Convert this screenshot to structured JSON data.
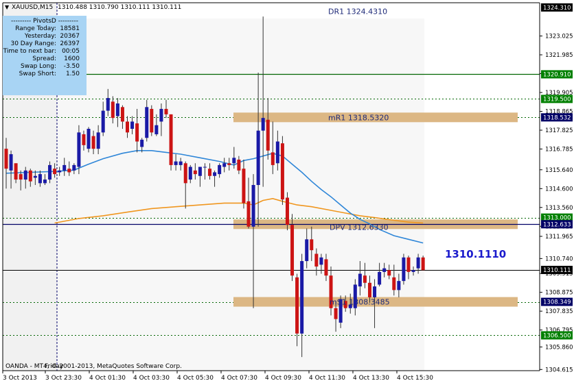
{
  "header": {
    "symbol": "XAUUSD,M15",
    "ohlc": "1310.488 1310.790 1310.111 1310.111"
  },
  "info_panel": {
    "title": "---------  PivotsD  ---------",
    "rows": [
      {
        "label": "Range  Today:",
        "value": "18581"
      },
      {
        "label": "Yesterday:",
        "value": "20367"
      },
      {
        "label": "30 Day Range:",
        "value": "26397"
      },
      {
        "label": "Time to next bar:",
        "value": "00:05"
      },
      {
        "label": "Spread:",
        "value": "1600"
      },
      {
        "label": "Swap  Long:",
        "value": "-3.50"
      },
      {
        "label": "Swap  Short:",
        "value": "1.50"
      }
    ]
  },
  "copyright": "OANDA - MT4, © 2001-2013, MetaQuotes Software Corp.",
  "friday_label": "Friday",
  "big_price": "1310.1110",
  "colors": {
    "bull": "#1a1aa6",
    "bear": "#cc1414",
    "ma_fast": "#2e86d8",
    "ma_slow": "#f0961e",
    "zone": "#dcb784",
    "green_line": "#006400",
    "navy_line": "#000066"
  },
  "chart_data": {
    "type": "candlestick",
    "ylim": [
      1304.55,
      1324.86
    ],
    "y_ticks": [
      "1323.025",
      "1321.985",
      "1320.945",
      "1319.905",
      "1318.865",
      "1317.825",
      "1316.785",
      "1315.640",
      "1314.600",
      "1313.560",
      "1312.520",
      "1311.965",
      "1310.740",
      "1309.915",
      "1308.875",
      "1307.835",
      "1306.795",
      "1305.860",
      "1304.615"
    ],
    "x_ticks": [
      "3 Oct 2013",
      "3 Oct 23:30",
      "4 Oct 01:30",
      "4 Oct 03:30",
      "4 Oct 05:30",
      "4 Oct 07:30",
      "4 Oct 09:30",
      "4 Oct 11:30",
      "4 Oct 13:30",
      "4 Oct 15:30"
    ],
    "price_labels": [
      {
        "text": "1324.310",
        "value": 1324.6,
        "bg": "#000000",
        "fg": "#ffffff"
      },
      {
        "text": "1320.910",
        "value": 1320.91,
        "bg": "#008000",
        "fg": "#ffffff"
      },
      {
        "text": "1319.500",
        "value": 1319.55,
        "bg": "#008000",
        "fg": "#ffffff"
      },
      {
        "text": "1318.532",
        "value": 1318.532,
        "bg": "#000066",
        "fg": "#ffffff"
      },
      {
        "text": "1313.000",
        "value": 1313.0,
        "bg": "#008000",
        "fg": "#ffffff"
      },
      {
        "text": "1312.633",
        "value": 1312.633,
        "bg": "#000066",
        "fg": "#ffffff"
      },
      {
        "text": "1310.111",
        "value": 1310.111,
        "bg": "#000000",
        "fg": "#ffffff"
      },
      {
        "text": "1308.349",
        "value": 1308.349,
        "bg": "#000066",
        "fg": "#ffffff"
      },
      {
        "text": "1306.500",
        "value": 1306.5,
        "bg": "#008000",
        "fg": "#ffffff"
      }
    ],
    "levels": [
      {
        "name": "DR1",
        "text": "DR1   1324.4310",
        "value": 1324.431
      },
      {
        "name": "mR1",
        "text": "mR1   1318.5320",
        "value": 1318.532
      },
      {
        "name": "DPV",
        "text": "DPV   1312.6330",
        "value": 1312.633
      },
      {
        "name": "mS1",
        "text": "mS1   1308.3485",
        "value": 1308.3485
      }
    ],
    "dashed_levels": [
      1319.55,
      1318.532,
      1313.0,
      1308.349,
      1306.5
    ],
    "candles": [
      {
        "o": 1316.8,
        "h": 1317.4,
        "l": 1314.6,
        "c": 1315.7
      },
      {
        "o": 1315.6,
        "h": 1316.7,
        "l": 1314.6,
        "c": 1316.5
      },
      {
        "o": 1316.0,
        "h": 1316.0,
        "l": 1314.9,
        "c": 1315.1
      },
      {
        "o": 1315.4,
        "h": 1315.6,
        "l": 1314.5,
        "c": 1315.1
      },
      {
        "o": 1315.1,
        "h": 1315.8,
        "l": 1314.6,
        "c": 1315.6
      },
      {
        "o": 1315.6,
        "h": 1315.7,
        "l": 1314.7,
        "c": 1315.0
      },
      {
        "o": 1315.2,
        "h": 1315.6,
        "l": 1314.8,
        "c": 1315.3
      },
      {
        "o": 1314.9,
        "h": 1315.6,
        "l": 1314.7,
        "c": 1315.4
      },
      {
        "o": 1314.9,
        "h": 1315.4,
        "l": 1314.8,
        "c": 1315.1
      },
      {
        "o": 1315.1,
        "h": 1316.1,
        "l": 1314.9,
        "c": 1315.9
      },
      {
        "o": 1315.7,
        "h": 1316.0,
        "l": 1315.2,
        "c": 1315.4
      },
      {
        "o": 1315.5,
        "h": 1315.8,
        "l": 1315.3,
        "c": 1315.6
      },
      {
        "o": 1315.6,
        "h": 1316.3,
        "l": 1315.3,
        "c": 1315.9
      },
      {
        "o": 1315.7,
        "h": 1316.1,
        "l": 1315.3,
        "c": 1315.5
      },
      {
        "o": 1315.6,
        "h": 1316.0,
        "l": 1315.4,
        "c": 1315.9
      },
      {
        "o": 1315.8,
        "h": 1318.1,
        "l": 1315.4,
        "c": 1317.7
      },
      {
        "o": 1317.6,
        "h": 1317.8,
        "l": 1316.7,
        "c": 1317.0
      },
      {
        "o": 1316.8,
        "h": 1318.0,
        "l": 1316.6,
        "c": 1317.9
      },
      {
        "o": 1317.5,
        "h": 1317.8,
        "l": 1316.5,
        "c": 1316.8
      },
      {
        "o": 1316.8,
        "h": 1318.1,
        "l": 1316.5,
        "c": 1317.7
      },
      {
        "o": 1317.7,
        "h": 1319.4,
        "l": 1317.5,
        "c": 1318.9
      },
      {
        "o": 1318.9,
        "h": 1320.1,
        "l": 1318.6,
        "c": 1319.6
      },
      {
        "o": 1319.4,
        "h": 1319.7,
        "l": 1318.2,
        "c": 1318.5
      },
      {
        "o": 1318.6,
        "h": 1319.6,
        "l": 1318.0,
        "c": 1319.3
      },
      {
        "o": 1319.1,
        "h": 1319.2,
        "l": 1317.9,
        "c": 1318.3
      },
      {
        "o": 1318.3,
        "h": 1318.6,
        "l": 1317.4,
        "c": 1317.7
      },
      {
        "o": 1317.9,
        "h": 1318.6,
        "l": 1317.6,
        "c": 1318.3
      },
      {
        "o": 1318.2,
        "h": 1319.0,
        "l": 1316.6,
        "c": 1317.2
      },
      {
        "o": 1316.9,
        "h": 1317.4,
        "l": 1316.6,
        "c": 1317.3
      },
      {
        "o": 1317.4,
        "h": 1319.5,
        "l": 1317.2,
        "c": 1319.1
      },
      {
        "o": 1319.0,
        "h": 1319.2,
        "l": 1317.5,
        "c": 1317.7
      },
      {
        "o": 1317.6,
        "h": 1318.7,
        "l": 1317.5,
        "c": 1318.1
      },
      {
        "o": 1318.3,
        "h": 1319.3,
        "l": 1317.5,
        "c": 1319.0
      },
      {
        "o": 1319.0,
        "h": 1319.5,
        "l": 1318.5,
        "c": 1318.7
      },
      {
        "o": 1318.7,
        "h": 1318.7,
        "l": 1315.6,
        "c": 1315.9
      },
      {
        "o": 1315.9,
        "h": 1316.5,
        "l": 1315.6,
        "c": 1316.1
      },
      {
        "o": 1315.9,
        "h": 1316.3,
        "l": 1315.6,
        "c": 1316.1
      },
      {
        "o": 1316.0,
        "h": 1316.1,
        "l": 1313.5,
        "c": 1314.9
      },
      {
        "o": 1315.1,
        "h": 1315.9,
        "l": 1314.9,
        "c": 1315.8
      },
      {
        "o": 1315.6,
        "h": 1316.0,
        "l": 1315.1,
        "c": 1315.4
      },
      {
        "o": 1315.3,
        "h": 1315.8,
        "l": 1314.7,
        "c": 1315.8
      },
      {
        "o": 1315.8,
        "h": 1316.0,
        "l": 1315.1,
        "c": 1315.8
      },
      {
        "o": 1315.7,
        "h": 1316.0,
        "l": 1315.1,
        "c": 1315.3
      },
      {
        "o": 1315.3,
        "h": 1315.6,
        "l": 1314.7,
        "c": 1315.5
      },
      {
        "o": 1315.4,
        "h": 1316.0,
        "l": 1315.2,
        "c": 1315.9
      },
      {
        "o": 1315.8,
        "h": 1316.3,
        "l": 1315.5,
        "c": 1316.0
      },
      {
        "o": 1316.0,
        "h": 1316.3,
        "l": 1315.6,
        "c": 1315.9
      },
      {
        "o": 1316.0,
        "h": 1316.9,
        "l": 1315.7,
        "c": 1316.3
      },
      {
        "o": 1316.2,
        "h": 1316.4,
        "l": 1315.4,
        "c": 1315.6
      },
      {
        "o": 1315.7,
        "h": 1316.2,
        "l": 1313.5,
        "c": 1313.8
      },
      {
        "o": 1313.9,
        "h": 1315.2,
        "l": 1312.4,
        "c": 1312.5
      },
      {
        "o": 1312.5,
        "h": 1315.4,
        "l": 1308.0,
        "c": 1314.8
      },
      {
        "o": 1314.8,
        "h": 1321.0,
        "l": 1312.5,
        "c": 1317.8
      },
      {
        "o": 1317.8,
        "h": 1324.1,
        "l": 1314.7,
        "c": 1318.5
      },
      {
        "o": 1318.4,
        "h": 1319.6,
        "l": 1316.2,
        "c": 1316.7
      },
      {
        "o": 1316.6,
        "h": 1318.3,
        "l": 1315.4,
        "c": 1315.9
      },
      {
        "o": 1316.0,
        "h": 1317.8,
        "l": 1315.6,
        "c": 1317.2
      },
      {
        "o": 1317.1,
        "h": 1317.5,
        "l": 1313.7,
        "c": 1314.0
      },
      {
        "o": 1314.1,
        "h": 1314.4,
        "l": 1312.3,
        "c": 1312.6
      },
      {
        "o": 1312.6,
        "h": 1313.2,
        "l": 1309.5,
        "c": 1309.8
      },
      {
        "o": 1309.7,
        "h": 1309.9,
        "l": 1305.9,
        "c": 1306.6
      },
      {
        "o": 1306.6,
        "h": 1311.0,
        "l": 1305.3,
        "c": 1310.6
      },
      {
        "o": 1310.6,
        "h": 1312.4,
        "l": 1310.2,
        "c": 1311.8
      },
      {
        "o": 1311.8,
        "h": 1312.5,
        "l": 1310.6,
        "c": 1311.2
      },
      {
        "o": 1311.0,
        "h": 1311.3,
        "l": 1309.8,
        "c": 1310.3
      },
      {
        "o": 1310.4,
        "h": 1311.0,
        "l": 1309.9,
        "c": 1310.8
      },
      {
        "o": 1310.7,
        "h": 1311.0,
        "l": 1309.5,
        "c": 1309.8
      },
      {
        "o": 1309.8,
        "h": 1310.3,
        "l": 1307.6,
        "c": 1308.0
      },
      {
        "o": 1308.0,
        "h": 1308.4,
        "l": 1306.7,
        "c": 1307.4
      },
      {
        "o": 1307.2,
        "h": 1308.7,
        "l": 1306.9,
        "c": 1308.5
      },
      {
        "o": 1308.4,
        "h": 1308.7,
        "l": 1307.8,
        "c": 1308.0
      },
      {
        "o": 1308.0,
        "h": 1308.8,
        "l": 1307.7,
        "c": 1308.2
      },
      {
        "o": 1308.0,
        "h": 1309.6,
        "l": 1307.6,
        "c": 1309.3
      },
      {
        "o": 1309.2,
        "h": 1310.6,
        "l": 1308.7,
        "c": 1309.9
      },
      {
        "o": 1309.8,
        "h": 1310.5,
        "l": 1309.1,
        "c": 1309.4
      },
      {
        "o": 1309.4,
        "h": 1309.8,
        "l": 1308.3,
        "c": 1308.6
      },
      {
        "o": 1308.6,
        "h": 1309.6,
        "l": 1306.9,
        "c": 1309.2
      },
      {
        "o": 1309.3,
        "h": 1310.5,
        "l": 1309.2,
        "c": 1310.0
      },
      {
        "o": 1310.0,
        "h": 1310.5,
        "l": 1309.7,
        "c": 1310.2
      },
      {
        "o": 1310.1,
        "h": 1310.4,
        "l": 1309.6,
        "c": 1309.8
      },
      {
        "o": 1309.7,
        "h": 1310.4,
        "l": 1308.7,
        "c": 1309.0
      },
      {
        "o": 1309.0,
        "h": 1309.9,
        "l": 1308.6,
        "c": 1309.5
      },
      {
        "o": 1309.5,
        "h": 1311.0,
        "l": 1309.3,
        "c": 1310.8
      },
      {
        "o": 1310.8,
        "h": 1310.9,
        "l": 1309.6,
        "c": 1310.0
      },
      {
        "o": 1310.0,
        "h": 1310.3,
        "l": 1309.8,
        "c": 1310.1
      },
      {
        "o": 1310.2,
        "h": 1311.0,
        "l": 1309.9,
        "c": 1310.8
      },
      {
        "o": 1310.8,
        "h": 1310.9,
        "l": 1310.1,
        "c": 1310.1
      }
    ],
    "ma_fast": [
      [
        0,
        1315.45
      ],
      [
        5,
        1315.5
      ],
      [
        10,
        1315.55
      ],
      [
        14,
        1315.62
      ],
      [
        17,
        1315.95
      ],
      [
        20,
        1316.25
      ],
      [
        24,
        1316.55
      ],
      [
        27,
        1316.7
      ],
      [
        30,
        1316.7
      ],
      [
        33,
        1316.6
      ],
      [
        36,
        1316.5
      ],
      [
        40,
        1316.3
      ],
      [
        44,
        1316.1
      ],
      [
        47,
        1315.9
      ],
      [
        49,
        1316.15
      ],
      [
        51,
        1316.25
      ],
      [
        53,
        1316.4
      ],
      [
        55,
        1316.55
      ],
      [
        57,
        1316.4
      ],
      [
        59,
        1315.95
      ],
      [
        61,
        1315.5
      ],
      [
        63,
        1315.0
      ],
      [
        65,
        1314.55
      ],
      [
        67,
        1314.15
      ],
      [
        69,
        1313.7
      ],
      [
        71,
        1313.25
      ],
      [
        73,
        1312.9
      ],
      [
        75,
        1312.65
      ],
      [
        77,
        1312.35
      ],
      [
        80,
        1312.0
      ],
      [
        83,
        1311.8
      ],
      [
        86,
        1311.6
      ]
    ],
    "ma_slow": [
      [
        10,
        1312.7
      ],
      [
        15,
        1312.95
      ],
      [
        20,
        1313.1
      ],
      [
        25,
        1313.3
      ],
      [
        30,
        1313.5
      ],
      [
        35,
        1313.6
      ],
      [
        40,
        1313.7
      ],
      [
        45,
        1313.8
      ],
      [
        49,
        1313.8
      ],
      [
        51,
        1313.7
      ],
      [
        53,
        1313.95
      ],
      [
        55,
        1314.05
      ],
      [
        57,
        1313.9
      ],
      [
        60,
        1313.7
      ],
      [
        63,
        1313.6
      ],
      [
        67,
        1313.4
      ],
      [
        70,
        1313.25
      ],
      [
        73,
        1313.1
      ],
      [
        76,
        1313.0
      ],
      [
        80,
        1312.85
      ],
      [
        83,
        1312.75
      ],
      [
        86,
        1312.7
      ]
    ]
  }
}
